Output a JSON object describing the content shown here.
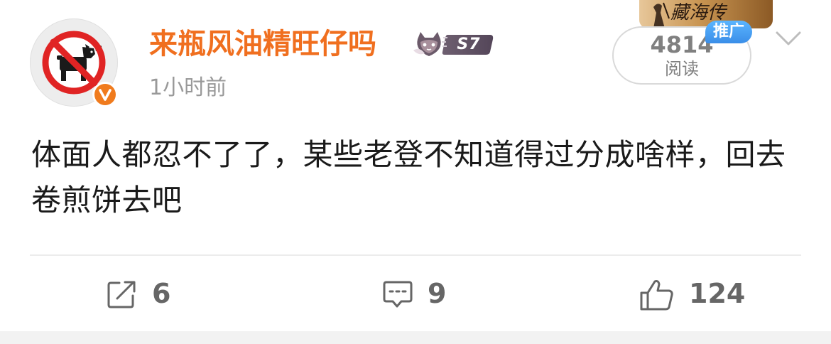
{
  "post": {
    "author": {
      "name": "来瓶风油精旺仔吗",
      "avatar_icon": "no-dog-sign-icon",
      "verified_icon": "orange-verified-v-icon",
      "badge_label": "S7"
    },
    "time": "1小时前",
    "reads": {
      "count": "4814",
      "label": "阅读"
    },
    "promo_tag": "推广",
    "ad_banner_text": "藏海传",
    "content": "体面人都忍不了了，某些老登不知道得过分成啥样，回去卷煎饼去吧",
    "actions": {
      "repost": {
        "icon": "share-icon",
        "count": "6"
      },
      "comment": {
        "icon": "comment-icon",
        "count": "9"
      },
      "like": {
        "icon": "thumbs-up-icon",
        "count": "124"
      }
    }
  },
  "colors": {
    "username": "#f06f1f",
    "muted_text": "#999999",
    "promo_tag": "#3a8ee8",
    "verified": "#f07b1d",
    "sign_red": "#e02424"
  }
}
